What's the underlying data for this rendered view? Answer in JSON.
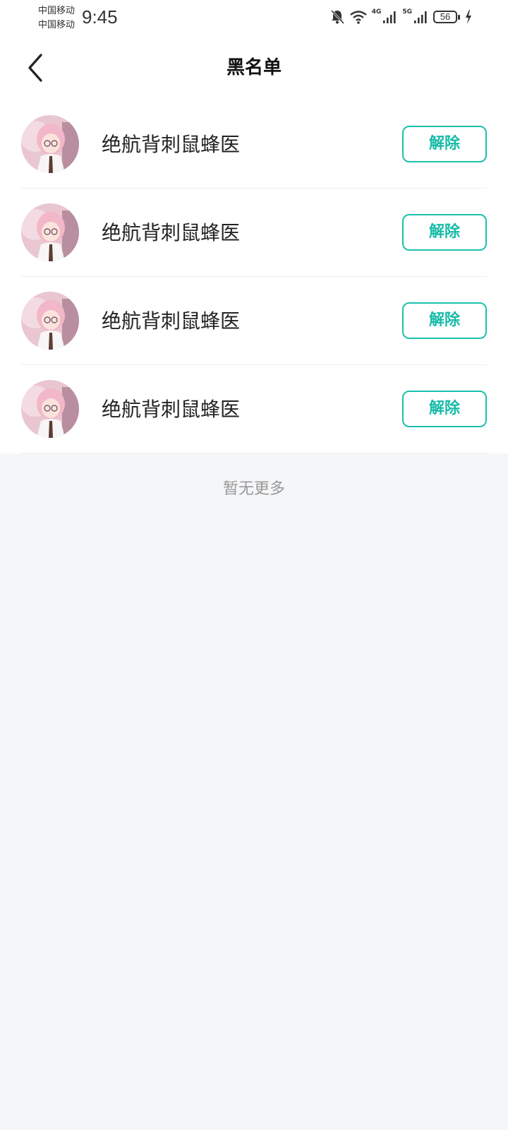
{
  "status_bar": {
    "carrier_1": "中国移动",
    "carrier_2": "中国移动",
    "time": "9:45",
    "network_1": "4G",
    "network_2": "5G",
    "battery": "56",
    "icons": [
      "mute-bell-icon",
      "wifi-icon",
      "signal-icon",
      "signal-icon",
      "battery-icon",
      "charging-icon"
    ]
  },
  "header": {
    "title": "黑名单",
    "back_icon": "chevron-left-icon"
  },
  "blocked_users": [
    {
      "name": "绝航背刺鼠蜂医",
      "action": "解除"
    },
    {
      "name": "绝航背刺鼠蜂医",
      "action": "解除"
    },
    {
      "name": "绝航背刺鼠蜂医",
      "action": "解除"
    },
    {
      "name": "绝航背刺鼠蜂医",
      "action": "解除"
    }
  ],
  "footer": {
    "end_text": "暂无更多"
  },
  "colors": {
    "accent": "#1bc1ad",
    "background": "#f5f6f8"
  }
}
